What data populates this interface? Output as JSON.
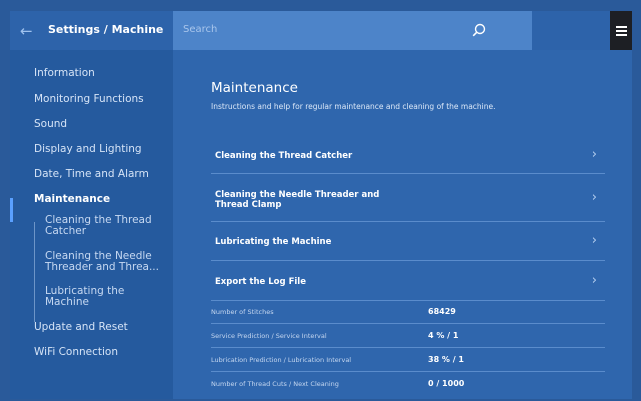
{
  "header": {
    "title": "Settings / Machine",
    "search_placeholder": "Search"
  },
  "sidebar": {
    "items": [
      {
        "label": "Information"
      },
      {
        "label": "Monitoring Functions"
      },
      {
        "label": "Sound"
      },
      {
        "label": "Display and Lighting"
      },
      {
        "label": "Date, Time and Alarm"
      },
      {
        "label": "Maintenance"
      },
      {
        "label": "Update and Reset"
      },
      {
        "label": "WiFi Connection"
      }
    ],
    "subitems": [
      {
        "line1": "Cleaning the Thread",
        "line2": "Catcher"
      },
      {
        "line1": "Cleaning the Needle",
        "line2": "Threader and Threa..."
      },
      {
        "line1": "Lubricating the",
        "line2": "Machine"
      }
    ]
  },
  "main": {
    "heading": "Maintenance",
    "description": "Instructions and help for regular maintenance and cleaning of the machine.",
    "links": [
      {
        "line1": "Cleaning the Thread Catcher",
        "line2": ""
      },
      {
        "line1": "Cleaning the Needle Threader and",
        "line2": "Thread Clamp"
      },
      {
        "line1": "Lubricating the Machine",
        "line2": ""
      },
      {
        "line1": "Export the Log File",
        "line2": ""
      }
    ],
    "stats": [
      {
        "key": "Number of Stitches",
        "value": "68429"
      },
      {
        "key": "Service Prediction / Service Interval",
        "value": "4 % / 1"
      },
      {
        "key": "Lubrication Prediction / Lubrication Interval",
        "value": "38 % / 1"
      },
      {
        "key": "Number of Thread Cuts / Next Cleaning",
        "value": "0 / 1000"
      }
    ]
  },
  "colors": {
    "background": "#2f66ad",
    "sidebar": "#255a9e",
    "search_field": "#4d84c9",
    "active_indicator": "#5aa0ff",
    "menu_button": "#1d1f24"
  },
  "icons": {
    "back": "arrow-left-icon",
    "search": "magnifier-icon",
    "menu": "hamburger-icon",
    "chevron": "chevron-right-icon"
  }
}
